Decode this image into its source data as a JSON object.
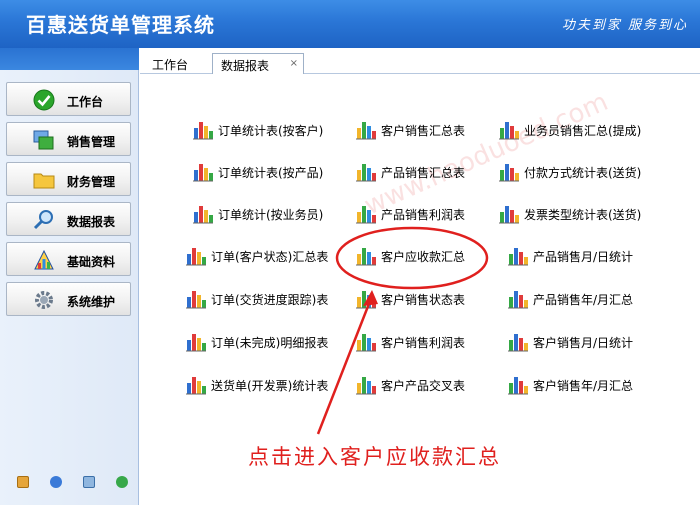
{
  "app": {
    "title": "百惠送货单管理系统",
    "slogan": "功夫到家 服务到心"
  },
  "sidebar": {
    "items": [
      {
        "label": "工作台",
        "icon": "check-icon"
      },
      {
        "label": "销售管理",
        "icon": "windows-icon"
      },
      {
        "label": "财务管理",
        "icon": "folder-icon"
      },
      {
        "label": "数据报表",
        "icon": "magnifier-icon"
      },
      {
        "label": "基础资料",
        "icon": "color-chart-icon"
      },
      {
        "label": "系统维护",
        "icon": "gear-icon"
      }
    ]
  },
  "tabs": [
    {
      "label": "工作台"
    },
    {
      "label": "数据报表",
      "close": "×"
    }
  ],
  "reports": {
    "col1": [
      "订单统计表(按客户)",
      "订单统计表(按产品)",
      "订单统计(按业务员)",
      "订单(客户状态)汇总表",
      "订单(交货进度跟踪)表",
      "订单(未完成)明细报表",
      "送货单(开发票)统计表"
    ],
    "col2": [
      "客户销售汇总表",
      "产品销售汇总表",
      "产品销售利润表",
      "客户应收款汇总",
      "客户销售状态表",
      "客户销售利润表",
      "客户产品交叉表"
    ],
    "col3": [
      "业务员销售汇总(提成)",
      "付款方式统计表(送货)",
      "发票类型统计表(送货)",
      "产品销售月/日统计",
      "产品销售年/月汇总",
      "客户销售月/日统计",
      "客户销售年/月汇总"
    ]
  },
  "watermark": "www.haoduoed.com",
  "annotation": "点击进入客户应收款汇总",
  "colors": {
    "header": "#2a76d6",
    "annotation": "#e0201e"
  }
}
